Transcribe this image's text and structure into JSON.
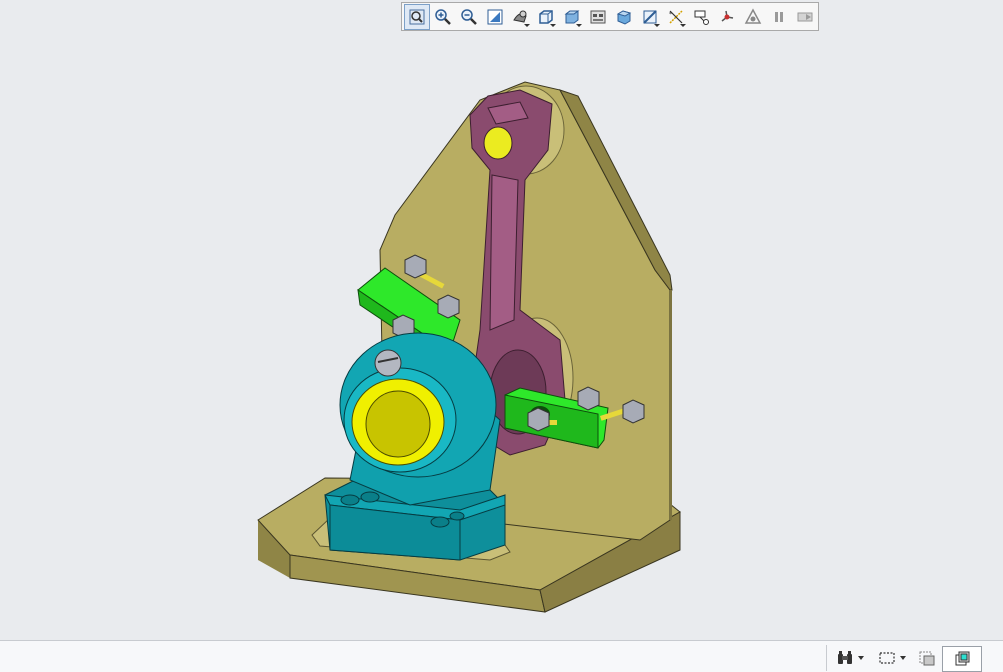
{
  "toolbar": {
    "buttons": [
      {
        "icon": "refit-icon",
        "active": true
      },
      {
        "icon": "zoom-in-icon"
      },
      {
        "icon": "zoom-out-icon"
      },
      {
        "icon": "repaint-icon"
      },
      {
        "icon": "reorient-icon",
        "dropdown": true
      },
      {
        "icon": "saved-views-icon",
        "dropdown": true
      },
      {
        "icon": "display-style-icon",
        "dropdown": true
      },
      {
        "icon": "view-manager-icon"
      },
      {
        "icon": "perspective-view-icon"
      },
      {
        "icon": "section-icon",
        "dropdown": true
      },
      {
        "icon": "datum-display-icon",
        "dropdown": true
      },
      {
        "icon": "annotation-display-icon"
      },
      {
        "icon": "spin-center-icon"
      },
      {
        "icon": "simulation-display-icon"
      },
      {
        "icon": "pause-icon",
        "disabled": true
      },
      {
        "icon": "playback-icon",
        "disabled": true
      }
    ]
  },
  "colors": {
    "plate": "#b8ad62",
    "rod": "#8a4b6e",
    "bearing": "#12a6b3",
    "bushing": "#f0f000",
    "clamp": "#2ee82a"
  },
  "statusbar": {
    "find_icon": "binoculars-icon",
    "selection_icon": "box-select-icon",
    "filter_icon": "selection-filter-icon",
    "view_icon": "model-view-icon"
  }
}
